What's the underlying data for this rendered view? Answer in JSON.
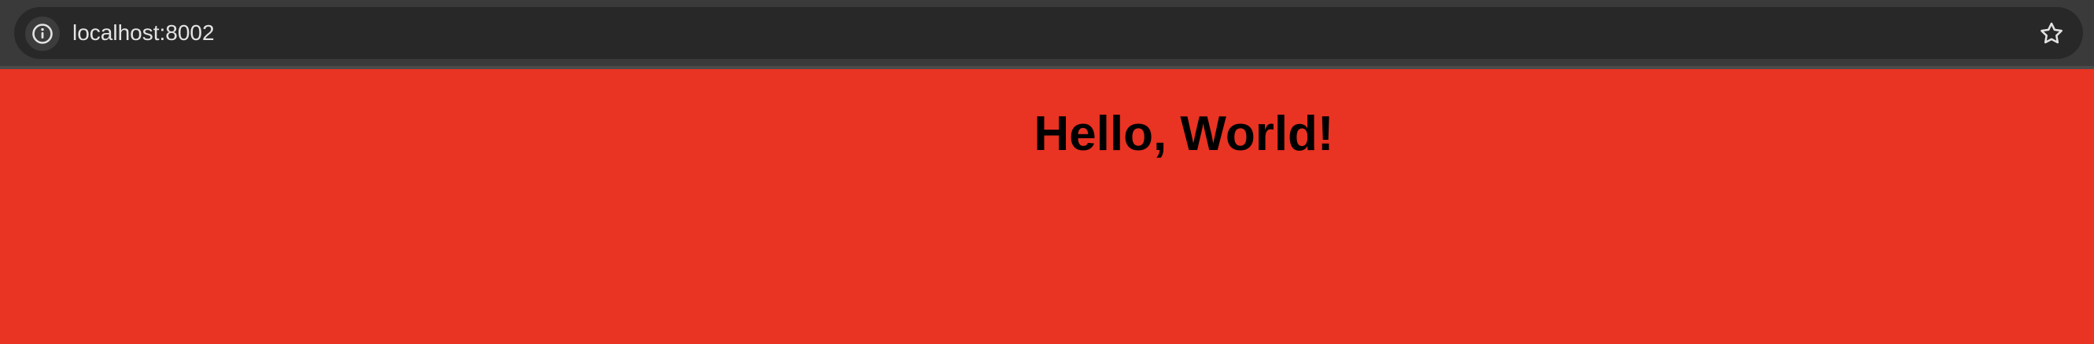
{
  "browser": {
    "url": "localhost:8002",
    "site_info_icon": "info-icon",
    "bookmark_icon": "star-icon"
  },
  "page": {
    "heading": "Hello, World!",
    "background_color": "#e93323",
    "text_color": "#000000"
  }
}
